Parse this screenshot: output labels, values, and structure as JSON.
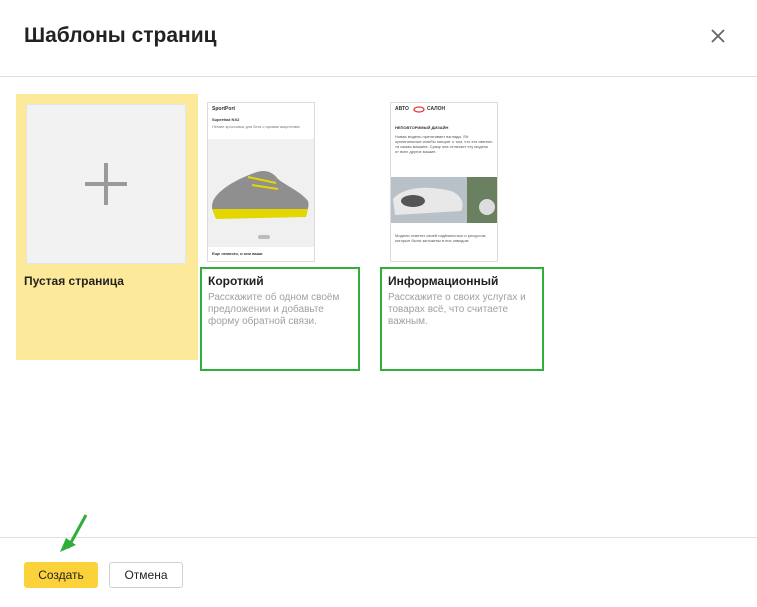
{
  "dialog": {
    "title": "Шаблоны страниц",
    "close_icon": "close-icon"
  },
  "templates": [
    {
      "id": "blank",
      "label": "Пустая страница",
      "icon": "plus-icon",
      "selected": true,
      "bg_color": "#fde99a"
    },
    {
      "id": "short",
      "label": "Короткий",
      "description": "Расскажите об одном своём предложении и добавьте форму обратной связи.",
      "highlight_color": "#2fae3a",
      "preview": {
        "brand": "SportPort",
        "heading": "Superfast NX2",
        "subtext": "Легкие кроссовки для бега с яркими акцентами",
        "footer": "Еще немного, и они ваши",
        "image": "sneaker"
      }
    },
    {
      "id": "info",
      "label": "Информационный",
      "description": "Расскажите о своих услугах и товарах всё, что считаете важным.",
      "highlight_color": "#2fae3a",
      "preview": {
        "brand_left": "АВТО",
        "brand_right": "САЛОН",
        "heading": "НЕПОВТОРИМЫЙ ДИЗАЙН",
        "body": "Новая модель притягивает взгляды. Её оригинальные изгибы говорят о том, что это именно та самая машина. Сразу она отличает эту модель от всех других машин.",
        "footer": "Модели отметят своей надёжностью и ресурсом, которые были заложены в них заводом.",
        "image": "car-headlight"
      }
    }
  ],
  "footer": {
    "create_label": "Создать",
    "cancel_label": "Отмена",
    "accent_color": "#fcd23a"
  },
  "annotation": {
    "arrow_icon": "green-arrow-icon",
    "color": "#2fae3a"
  }
}
